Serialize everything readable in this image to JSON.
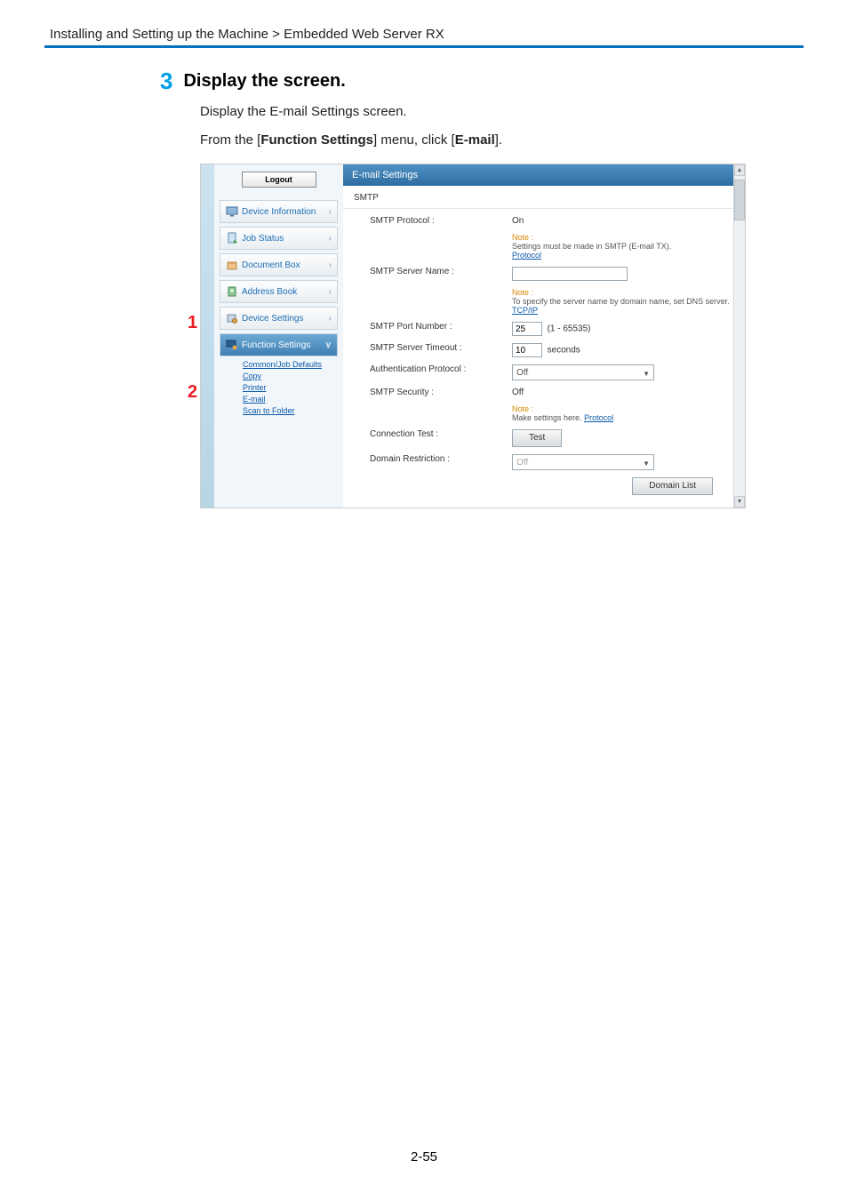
{
  "breadcrumb": "Installing and Setting up the Machine > Embedded Web Server RX",
  "step": {
    "number": "3",
    "title": "Display the screen."
  },
  "instructions": {
    "line1": "Display the E-mail Settings screen.",
    "line2_pre": "From the [",
    "line2_bold1": "Function Settings",
    "line2_mid": "] menu, click [",
    "line2_bold2": "E-mail",
    "line2_post": "]."
  },
  "sidebar": {
    "logout": "Logout",
    "items": [
      {
        "label": "Device Information"
      },
      {
        "label": "Job Status"
      },
      {
        "label": "Document Box"
      },
      {
        "label": "Address Book"
      },
      {
        "label": "Device Settings"
      },
      {
        "label": "Function Settings"
      }
    ],
    "sublinks": {
      "common": "Common/Job Defaults",
      "copy": "Copy",
      "printer": "Printer",
      "email": "E-mail",
      "scan": "Scan to Folder"
    }
  },
  "panel": {
    "title": "E-mail Settings",
    "section": "SMTP",
    "rows": {
      "protocol_label": "SMTP Protocol :",
      "protocol_value": "On",
      "protocol_note": "Note :",
      "protocol_note_text": "Settings must be made in SMTP (E-mail TX).",
      "protocol_link": "Protocol",
      "server_label": "SMTP Server Name :",
      "server_note": "Note :",
      "server_note_text": "To specify the server name by domain name, set DNS server.",
      "server_link": "TCP/IP",
      "port_label": "SMTP Port Number :",
      "port_value": "25",
      "port_range": "(1 - 65535)",
      "timeout_label": "SMTP Server Timeout :",
      "timeout_value": "10",
      "timeout_unit": "seconds",
      "auth_label": "Authentication Protocol :",
      "auth_value": "Off",
      "security_label": "SMTP Security :",
      "security_value": "Off",
      "security_note": "Note :",
      "security_note_text": "Make settings here.",
      "security_link": "Protocol",
      "conn_label": "Connection Test :",
      "conn_btn": "Test",
      "domain_label": "Domain Restriction :",
      "domain_value": "Off",
      "domain_btn": "Domain List"
    }
  },
  "callouts": {
    "one": "1",
    "two": "2"
  },
  "pagenum": "2-55"
}
